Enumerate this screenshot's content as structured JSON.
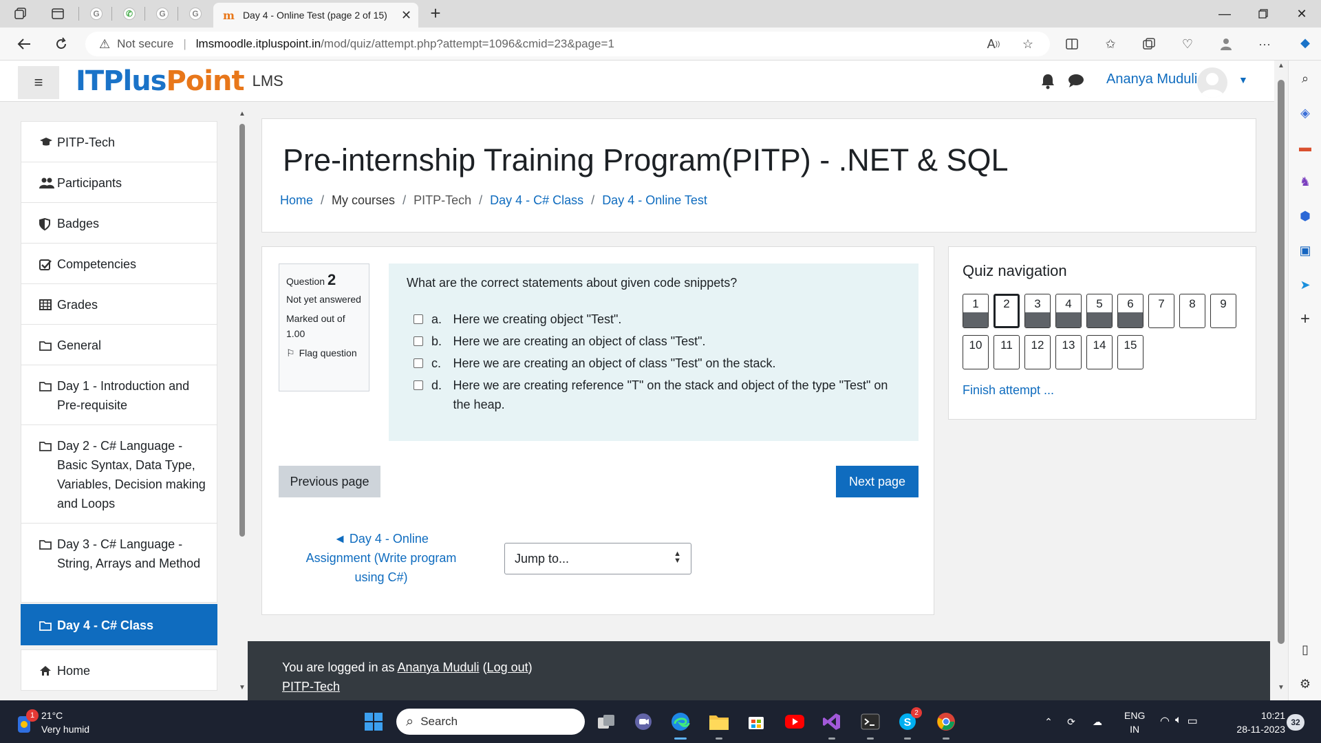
{
  "browser": {
    "active_tab_title": "Day 4 - Online Test (page 2 of 15)",
    "url_warning": "Not secure",
    "url_host": "lmsmoodle.itpluspoint.in",
    "url_path": "/mod/quiz/attempt.php?attempt=1096&cmid=23&page=1"
  },
  "site": {
    "logo_it": "IT",
    "logo_plus": "Plus",
    "logo_point": "Point",
    "lms_label": "LMS",
    "user_name": "Ananya Muduli"
  },
  "drawer": {
    "items": [
      {
        "label": "PITP-Tech",
        "icon": "graduation-cap-icon"
      },
      {
        "label": "Participants",
        "icon": "users-icon"
      },
      {
        "label": "Badges",
        "icon": "shield-icon"
      },
      {
        "label": "Competencies",
        "icon": "check-square-icon"
      },
      {
        "label": "Grades",
        "icon": "table-icon"
      },
      {
        "label": "General",
        "icon": "folder-icon"
      },
      {
        "label": "Day 1 - Introduction and Pre-requisite",
        "icon": "folder-icon"
      },
      {
        "label": "Day 2 - C# Language - Basic Syntax, Data Type, Variables, Decision making and Loops",
        "icon": "folder-icon"
      },
      {
        "label": "Day 3 - C# Language - String, Arrays and Method",
        "icon": "folder-icon"
      },
      {
        "label": "Day 4 - C# Class",
        "icon": "folder-icon"
      },
      {
        "label": "Home",
        "icon": "home-icon"
      }
    ]
  },
  "header": {
    "title": "Pre-internship Training Program(PITP) - .NET & SQL",
    "breadcrumb": [
      "Home",
      "My courses",
      "PITP-Tech",
      "Day 4 - C# Class",
      "Day 4 - Online Test"
    ]
  },
  "question": {
    "label": "Question",
    "number": "2",
    "status": "Not yet answered",
    "marked": "Marked out of 1.00",
    "flag": "Flag question",
    "text": "What are the correct statements about given code snippets?",
    "answers": [
      {
        "letter": "a.",
        "text": "Here we creating object \"Test\"."
      },
      {
        "letter": "b.",
        "text": "Here we are creating an object of class \"Test\"."
      },
      {
        "letter": "c.",
        "text": "Here we are creating an object of class \"Test\" on the stack."
      },
      {
        "letter": "d.",
        "text": "Here we are creating reference \"T\" on the stack and object of the type \"Test\" on the heap."
      }
    ]
  },
  "actions": {
    "prev": "Previous page",
    "next": "Next page",
    "prev_activity": "◄ Day 4 - Online Assignment (Write program using C#)",
    "jump": "Jump to..."
  },
  "quiz_nav": {
    "title": "Quiz navigation",
    "questions": [
      {
        "n": "1",
        "answered": true
      },
      {
        "n": "2",
        "answered": false,
        "current": true
      },
      {
        "n": "3",
        "answered": true
      },
      {
        "n": "4",
        "answered": true
      },
      {
        "n": "5",
        "answered": true
      },
      {
        "n": "6",
        "answered": true
      },
      {
        "n": "7",
        "answered": false
      },
      {
        "n": "8",
        "answered": false
      },
      {
        "n": "9",
        "answered": false
      },
      {
        "n": "10",
        "answered": false
      },
      {
        "n": "11",
        "answered": false
      },
      {
        "n": "12",
        "answered": false
      },
      {
        "n": "13",
        "answered": false
      },
      {
        "n": "14",
        "answered": false
      },
      {
        "n": "15",
        "answered": false
      }
    ],
    "finish": "Finish attempt ..."
  },
  "footer": {
    "logged_in_as": "You are logged in as",
    "user": "Ananya Muduli",
    "logout": "Log out",
    "course": "PITP-Tech"
  },
  "taskbar": {
    "weather_temp": "21°C",
    "weather_desc": "Very humid",
    "weather_badge": "1",
    "search": "Search",
    "skype_badge": "2",
    "lang1": "ENG",
    "lang2": "IN",
    "time": "10:21",
    "date": "28-11-2023",
    "notifications": "32"
  },
  "colors": {
    "primary": "#0f6cbf",
    "footer_bg": "#343a40",
    "question_bg": "#e7f3f5",
    "taskbar_bg": "#1c2230"
  }
}
